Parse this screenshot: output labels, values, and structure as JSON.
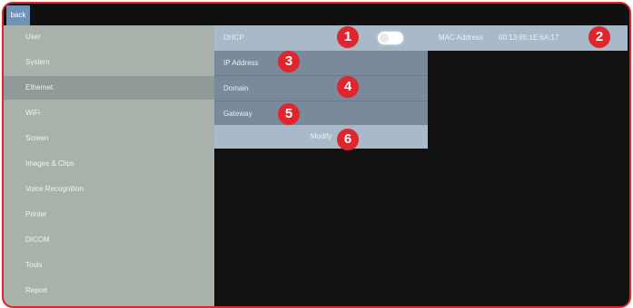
{
  "topbar": {
    "back_label": "back"
  },
  "sidebar": {
    "items": [
      {
        "label": "User"
      },
      {
        "label": "System"
      },
      {
        "label": "Ethernet"
      },
      {
        "label": "WiFi"
      },
      {
        "label": "Screen"
      },
      {
        "label": "Images & Clips"
      },
      {
        "label": "Voice Recognition"
      },
      {
        "label": "Printer"
      },
      {
        "label": "DICOM"
      },
      {
        "label": "Tools"
      },
      {
        "label": "Report"
      }
    ]
  },
  "ethernet": {
    "dhcp_label": "DHCP",
    "dhcp_state": "on",
    "ip_address_label": "IP Address",
    "domain_label": "Domain",
    "gateway_label": "Gateway",
    "modify_label": "Modify",
    "mac_label": "MAC Address",
    "mac_value": "00:13:95:1E:6A:17"
  },
  "callouts": [
    "1",
    "2",
    "3",
    "4",
    "5",
    "6"
  ],
  "colors": {
    "callout": "#e0262d",
    "sidebar_bg": "#a8b1aa",
    "sidebar_active": "#8f9a99",
    "panel_header": "#a8b9c9",
    "panel_row": "#7b8a9a",
    "background": "#111111"
  }
}
